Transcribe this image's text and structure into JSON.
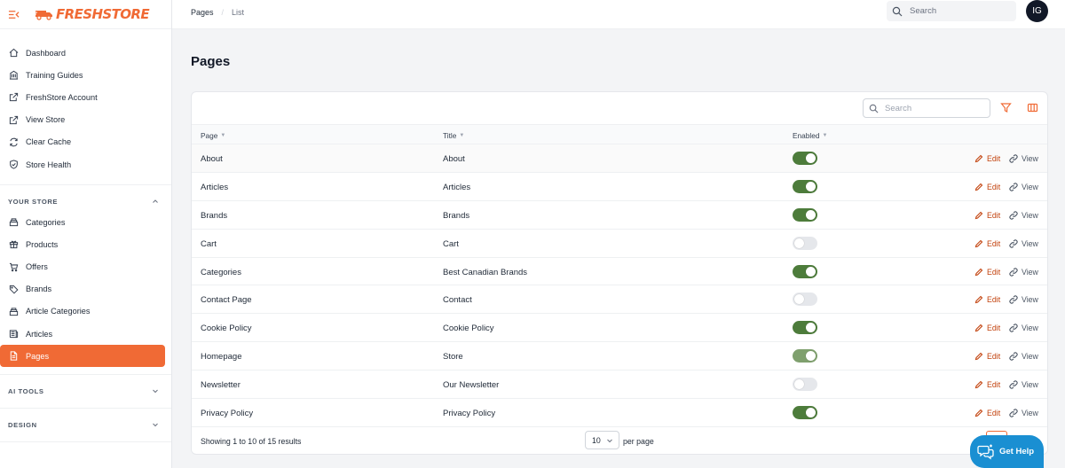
{
  "app": {
    "brand": "FRESHSTORE",
    "brand_color": "#f06a35"
  },
  "topbar": {
    "breadcrumb": [
      "Pages",
      "List"
    ],
    "search_placeholder": "Search",
    "avatar_initials": "IG"
  },
  "sidebar": {
    "items": [
      {
        "label": "Dashboard",
        "icon": "home-icon"
      },
      {
        "label": "Training Guides",
        "icon": "building-icon"
      },
      {
        "label": "FreshStore Account",
        "icon": "external-link-icon"
      },
      {
        "label": "View Store",
        "icon": "external-link-icon"
      },
      {
        "label": "Clear Cache",
        "icon": "refresh-icon"
      },
      {
        "label": "Store Health",
        "icon": "shield-check-icon"
      }
    ],
    "your_store": {
      "label": "YOUR STORE",
      "expanded": true,
      "items": [
        {
          "label": "Categories",
          "icon": "stack-icon"
        },
        {
          "label": "Products",
          "icon": "gift-icon"
        },
        {
          "label": "Offers",
          "icon": "cart-icon"
        },
        {
          "label": "Brands",
          "icon": "tag-icon"
        },
        {
          "label": "Article Categories",
          "icon": "stack-icon"
        },
        {
          "label": "Articles",
          "icon": "newspaper-icon"
        },
        {
          "label": "Pages",
          "icon": "document-icon",
          "active": true
        }
      ]
    },
    "ai_tools": {
      "label": "AI TOOLS",
      "expanded": false
    },
    "design": {
      "label": "DESIGN",
      "expanded": false
    }
  },
  "main": {
    "title": "Pages",
    "table": {
      "search_placeholder": "Search",
      "columns": [
        "Page",
        "Title",
        "Enabled"
      ],
      "rows": [
        {
          "page": "About",
          "title": "About",
          "enabled": true
        },
        {
          "page": "Articles",
          "title": "Articles",
          "enabled": true
        },
        {
          "page": "Brands",
          "title": "Brands",
          "enabled": true
        },
        {
          "page": "Cart",
          "title": "Cart",
          "enabled": false
        },
        {
          "page": "Categories",
          "title": "Best Canadian Brands",
          "enabled": true
        },
        {
          "page": "Contact Page",
          "title": "Contact",
          "enabled": false
        },
        {
          "page": "Cookie Policy",
          "title": "Cookie Policy",
          "enabled": true
        },
        {
          "page": "Homepage",
          "title": "Store",
          "enabled": true,
          "dimmed": true
        },
        {
          "page": "Newsletter",
          "title": "Our Newsletter",
          "enabled": false
        },
        {
          "page": "Privacy Policy",
          "title": "Privacy Policy",
          "enabled": true
        }
      ],
      "edit_label": "Edit",
      "view_label": "View",
      "footer": {
        "showing": "Showing 1 to 10 of 15 results",
        "per_page_value": "10",
        "per_page_label": "per page"
      }
    }
  },
  "help": {
    "label": "Get Help",
    "color": "#1a8fd2"
  },
  "colors": {
    "toggle_on": "#4d7c3b",
    "toggle_off": "#e5e7eb",
    "edit": "#c2410c"
  }
}
